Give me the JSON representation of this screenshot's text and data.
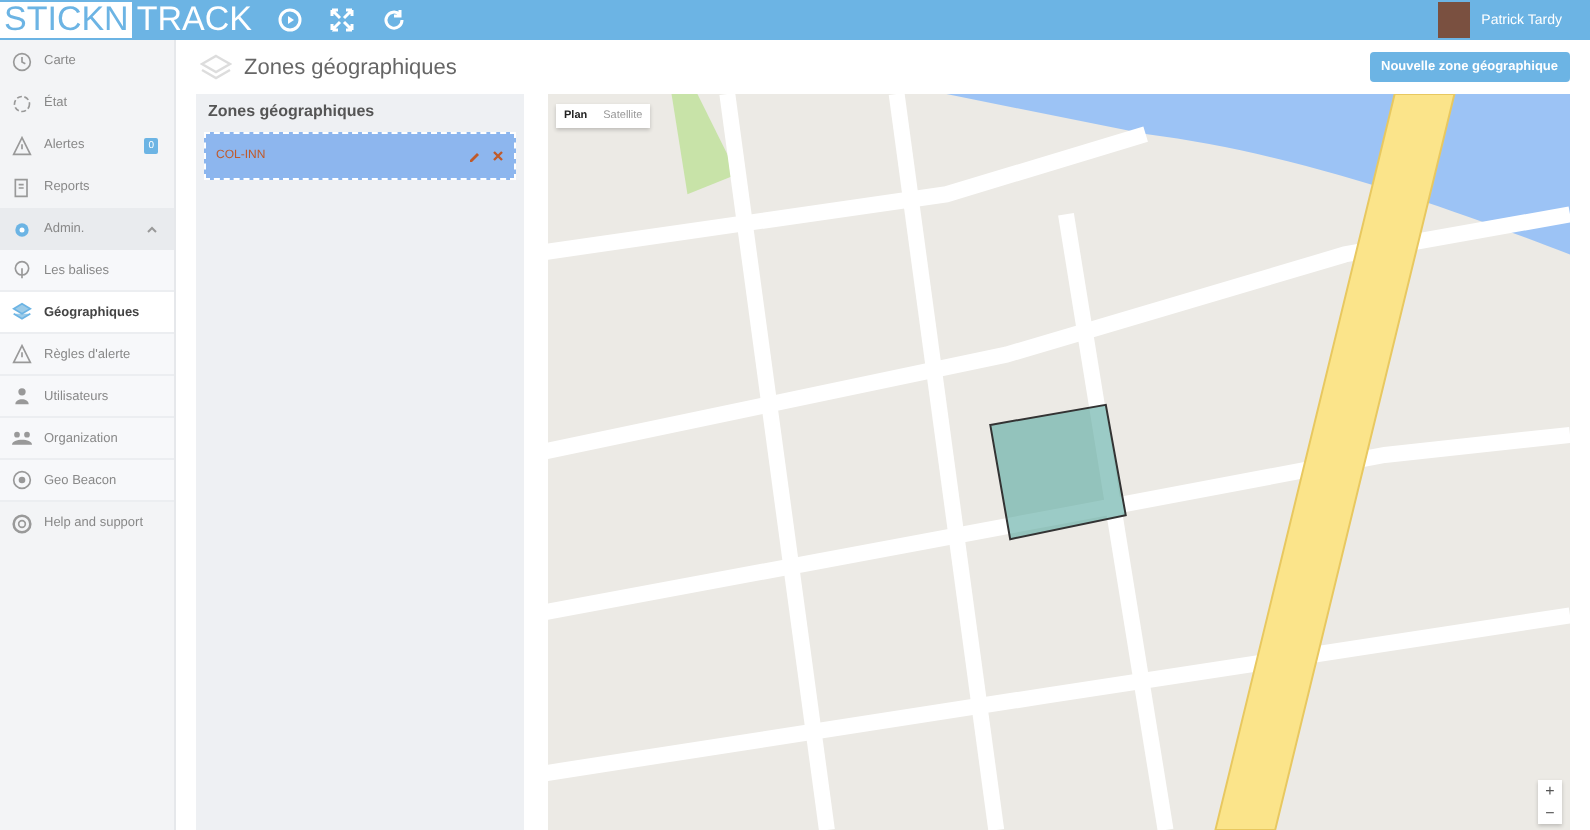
{
  "header": {
    "logo": {
      "part_1": "STICKN",
      "part_2": "TRACK"
    },
    "user_name": "Patrick Tardy"
  },
  "sidebar": {
    "items": [
      {
        "label": "Carte",
        "kind": "clock",
        "selected": false
      },
      {
        "label": "État",
        "kind": "spinner",
        "selected": false
      },
      {
        "label": "Alertes",
        "kind": "warning",
        "selected": false,
        "badge": "0"
      },
      {
        "label": "Reports",
        "kind": "report",
        "selected": false
      },
      {
        "label": "Admin.",
        "kind": "gear",
        "selected": false,
        "expanded": true,
        "children": [
          {
            "label": "Les balises",
            "kind": "beacon",
            "selected": false
          },
          {
            "label": "Géographiques",
            "kind": "layers",
            "selected": true
          },
          {
            "label": "Règles d'alerte",
            "kind": "warning",
            "selected": false
          },
          {
            "label": "Utilisateurs",
            "kind": "user",
            "selected": false
          },
          {
            "label": "Organization",
            "kind": "group",
            "selected": false
          },
          {
            "label": "Geo Beacon",
            "kind": "target",
            "selected": false
          }
        ]
      },
      {
        "label": "Help and support",
        "kind": "help",
        "selected": false
      }
    ]
  },
  "page": {
    "title": "Zones géographiques",
    "new_button": "Nouvelle zone géographique"
  },
  "zones_panel": {
    "title": "Zones géographiques",
    "zones": [
      {
        "name": "COL-INN",
        "selected": true
      }
    ]
  },
  "map": {
    "type_tabs": [
      {
        "label": "Plan",
        "selected": true
      },
      {
        "label": "Satellite",
        "selected": false
      }
    ],
    "zoom_in": "+",
    "zoom_out": "−"
  }
}
